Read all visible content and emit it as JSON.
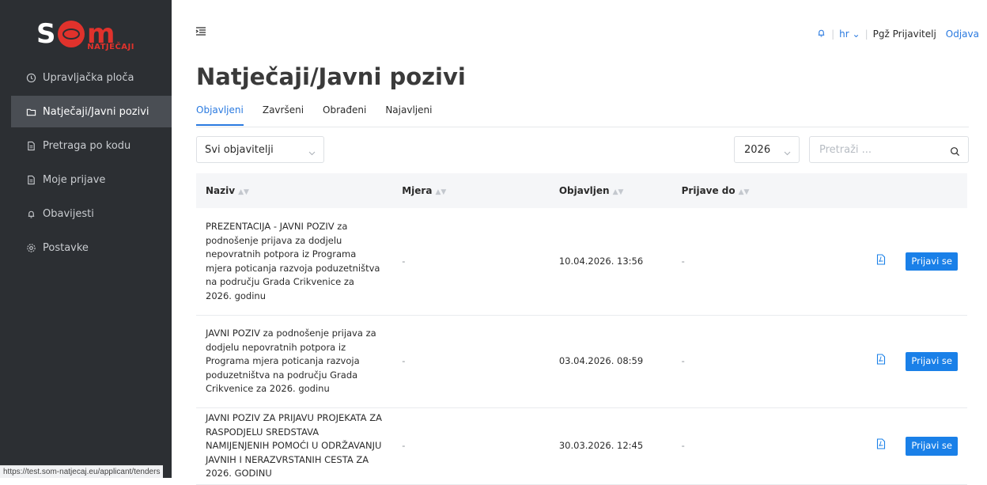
{
  "logo": {
    "sub": "NATJEČAJI"
  },
  "sidebar": {
    "items": [
      {
        "label": "Upravljačka ploča",
        "icon": "clock-icon"
      },
      {
        "label": "Natječaji/Javni pozivi",
        "icon": "folder-icon"
      },
      {
        "label": "Pretraga po kodu",
        "icon": "document-icon"
      },
      {
        "label": "Moje prijave",
        "icon": "document-icon"
      },
      {
        "label": "Obavijesti",
        "icon": "bell-icon"
      },
      {
        "label": "Postavke",
        "icon": "gear-icon"
      }
    ]
  },
  "statusbar": {
    "url": "https://test.som-natjecaj.eu/applicant/tenders"
  },
  "header": {
    "lang": "hr",
    "user": "Pgž Prijavitelj",
    "logout": "Odjava"
  },
  "page": {
    "title": "Natječaji/Javni pozivi"
  },
  "tabs": [
    {
      "label": "Objavljeni",
      "active": true
    },
    {
      "label": "Završeni",
      "active": false
    },
    {
      "label": "Obrađeni",
      "active": false
    },
    {
      "label": "Najavljeni",
      "active": false
    }
  ],
  "filters": {
    "publisher": "Svi objavitelji",
    "year": "2026",
    "search_placeholder": "Pretraži ..."
  },
  "table": {
    "columns": [
      "Naziv",
      "Mjera",
      "Objavljen",
      "Prijave do"
    ],
    "rows": [
      {
        "naziv": "PREZENTACIJA - JAVNI POZIV za podnošenje prijava za dodjelu nepovratnih potpora iz Programa mjera poticanja razvoja poduzetništva na području Grada Crikvenice za 2026. godinu",
        "mjera": "-",
        "objavljen": "10.04.2026. 13:56",
        "prijave_do": "-",
        "action": "Prijavi se"
      },
      {
        "naziv": "JAVNI POZIV za podnošenje prijava za dodjelu nepovratnih potpora iz Programa mjera poticanja razvoja poduzetništva na području Grada Crikvenice za 2026. godinu",
        "mjera": "-",
        "objavljen": "03.04.2026. 08:59",
        "prijave_do": "-",
        "action": "Prijavi se"
      },
      {
        "naziv": "JAVNI POZIV ZA PRIJAVU PROJEKATA ZA RASPODJELU SREDSTAVA NAMIJENJENIH POMOĆI U ODRŽAVANJU JAVNIH I NERAZVRSTANIH CESTA ZA 2026. GODINU",
        "mjera": "-",
        "objavljen": "30.03.2026. 12:45",
        "prijave_do": "-",
        "action": "Prijavi se"
      }
    ]
  },
  "colors": {
    "accent": "#2a7ae0",
    "button": "#1a80e8",
    "sidebar": "#2c2f33",
    "brand_red": "#e0322c"
  }
}
